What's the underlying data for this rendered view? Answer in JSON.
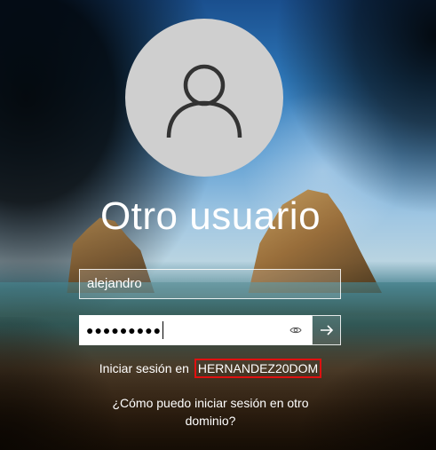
{
  "login": {
    "title": "Otro usuario",
    "username_value": "alejandro",
    "password_mask": "●●●●●●●●●",
    "signin_prefix": "Iniciar sesión en",
    "domain": "HERNANDEZ20DOM",
    "help_link": "¿Cómo puedo iniciar sesión en otro dominio?"
  },
  "icons": {
    "avatar": "user-silhouette-icon",
    "reveal": "eye-icon",
    "submit": "arrow-right-icon"
  },
  "colors": {
    "highlight": "#e01010",
    "avatar_bg": "#cfcfcf",
    "text": "#ffffff"
  }
}
